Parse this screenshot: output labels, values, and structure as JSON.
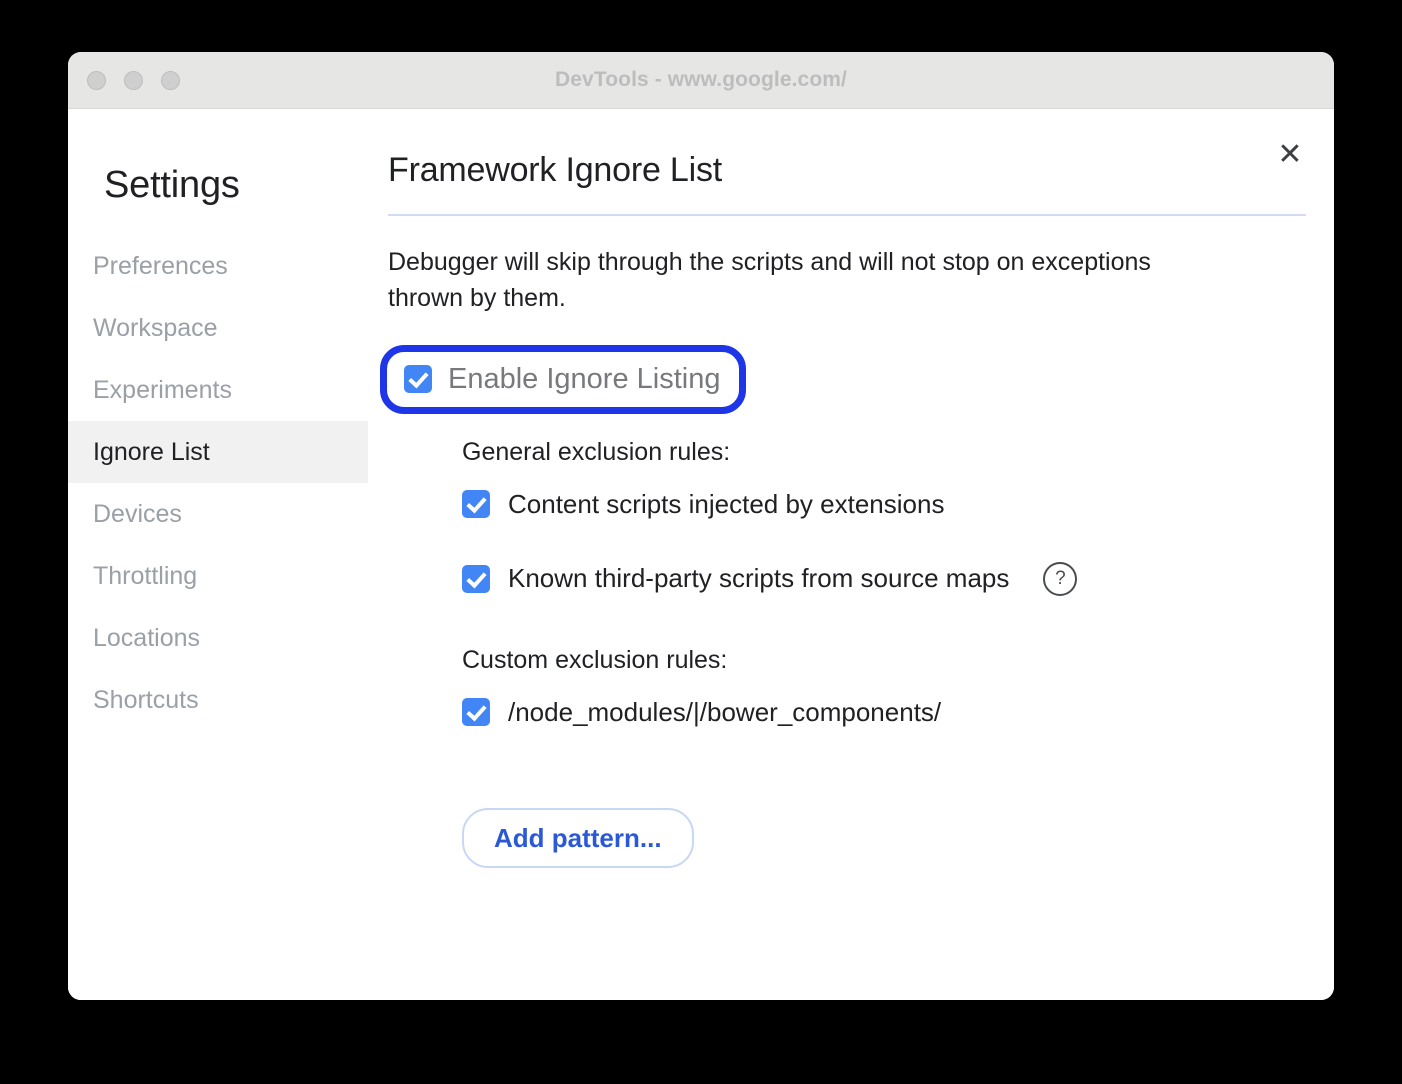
{
  "window": {
    "title": "DevTools - www.google.com/",
    "traffic_lights": [
      "close",
      "minimize",
      "maximize"
    ]
  },
  "sidebar": {
    "title": "Settings",
    "items": [
      {
        "label": "Preferences",
        "selected": false
      },
      {
        "label": "Workspace",
        "selected": false
      },
      {
        "label": "Experiments",
        "selected": false
      },
      {
        "label": "Ignore List",
        "selected": true
      },
      {
        "label": "Devices",
        "selected": false
      },
      {
        "label": "Throttling",
        "selected": false
      },
      {
        "label": "Locations",
        "selected": false
      },
      {
        "label": "Shortcuts",
        "selected": false
      }
    ]
  },
  "panel": {
    "title": "Framework Ignore List",
    "description": "Debugger will skip through the scripts and will not stop on exceptions thrown by them.",
    "close_label": "✕",
    "enable": {
      "label": "Enable Ignore Listing",
      "checked": true,
      "highlighted": true
    },
    "general": {
      "heading": "General exclusion rules:",
      "rules": [
        {
          "label": "Content scripts injected by extensions",
          "checked": true,
          "help": false
        },
        {
          "label": "Known third-party scripts from source maps",
          "checked": true,
          "help": true,
          "help_glyph": "?"
        }
      ]
    },
    "custom": {
      "heading": "Custom exclusion rules:",
      "rules": [
        {
          "label": "/node_modules/|/bower_components/",
          "checked": true
        }
      ],
      "add_button_label": "Add pattern..."
    }
  },
  "colors": {
    "accent_blue": "#4285f4",
    "highlight_ring": "#1f35e8",
    "link_blue": "#2b59d6",
    "titlebar_bg": "#e6e6e5",
    "selected_row_bg": "#f1f1f1",
    "divider": "#d2dcf2"
  }
}
